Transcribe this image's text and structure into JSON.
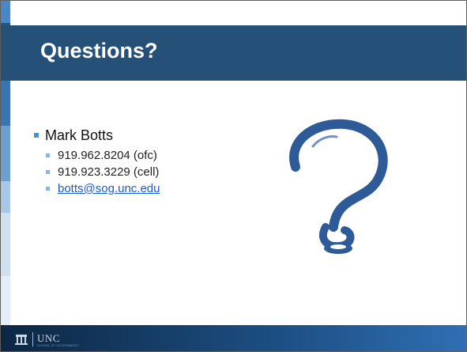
{
  "title": "Questions?",
  "bullets": {
    "main": "Mark Botts",
    "items": [
      {
        "text": "919.962.8204 (ofc)",
        "link": false
      },
      {
        "text": "919.923.3229 (cell)",
        "link": false
      },
      {
        "text": "botts@sog.unc.edu",
        "link": true
      }
    ]
  },
  "image": {
    "icon": "question-mark-ribbon-icon",
    "color": "#2f5a98"
  },
  "footer": {
    "logo_text": "UNC",
    "sub_text": "SCHOOL OF GOVERNMENT"
  },
  "colors": {
    "title_bar": "#255078",
    "bullet": "#4a90d6",
    "sub_bullet": "#8cb6e0",
    "link": "#1a5bd6",
    "footer_dark": "#0c2742",
    "footer_light": "#2f6fb3"
  }
}
